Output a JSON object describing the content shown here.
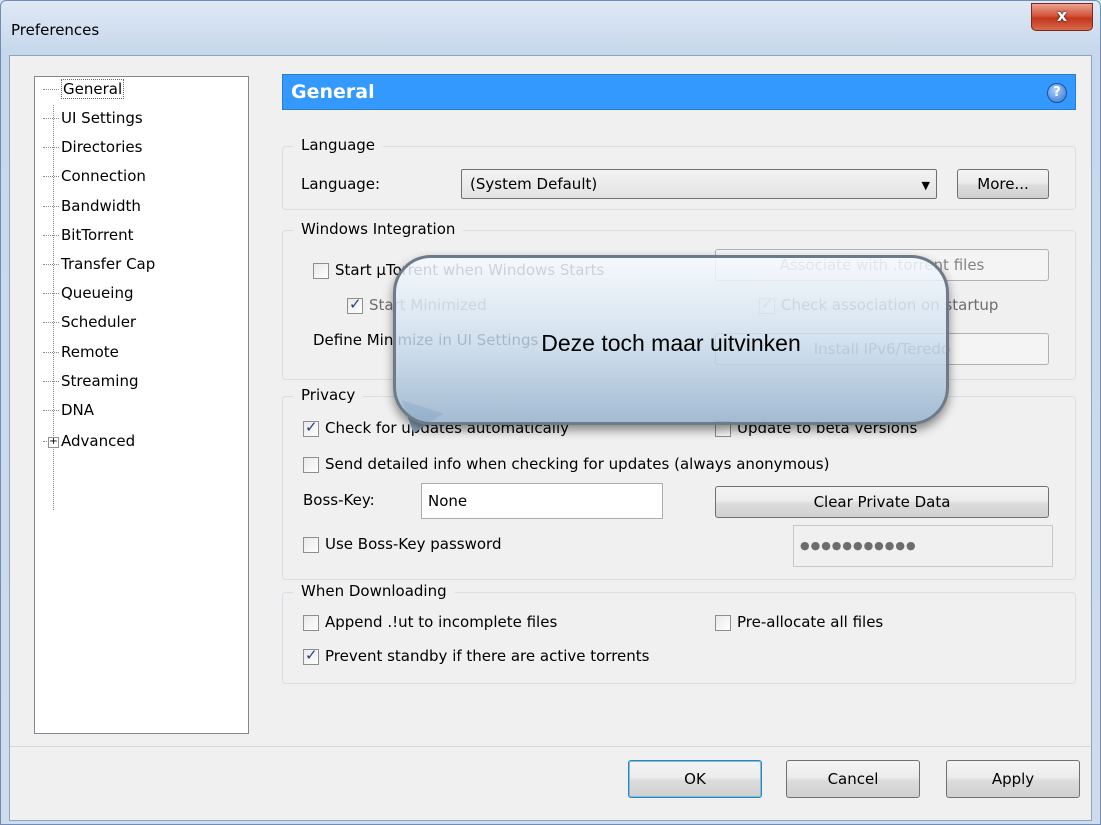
{
  "window": {
    "title": "Preferences",
    "close_label": "x"
  },
  "tree": {
    "items": [
      {
        "label": "General"
      },
      {
        "label": "UI Settings"
      },
      {
        "label": "Directories"
      },
      {
        "label": "Connection"
      },
      {
        "label": "Bandwidth"
      },
      {
        "label": "BitTorrent"
      },
      {
        "label": "Transfer Cap"
      },
      {
        "label": "Queueing"
      },
      {
        "label": "Scheduler"
      },
      {
        "label": "Remote"
      },
      {
        "label": "Streaming"
      },
      {
        "label": "DNA"
      },
      {
        "label": "Advanced"
      }
    ],
    "expander_symbol": "+"
  },
  "header": {
    "title": "General",
    "help": "?"
  },
  "language": {
    "group_title": "Language",
    "label": "Language:",
    "selected": "(System Default)",
    "more_button": "More..."
  },
  "windows_integration": {
    "group_title": "Windows Integration",
    "start_on_boot": "Start µTorrent when Windows Starts",
    "start_minimized": "Start Minimized",
    "associate_button": "Associate with .torrent files",
    "check_association": "Check association on startup",
    "define_minimize": "Define Minimize in UI Settings",
    "install_ipv6": "Install IPv6/Teredo"
  },
  "privacy": {
    "group_title": "Privacy",
    "check_updates": "Check for updates automatically",
    "beta_versions": "Update to beta versions",
    "send_info": "Send detailed info when checking for updates (always anonymous)",
    "boss_key_label": "Boss-Key:",
    "boss_key_value": "None",
    "clear_private": "Clear Private Data",
    "boss_password": "Use Boss-Key password",
    "password_mask": "●●●●●●●●●●●"
  },
  "downloading": {
    "group_title": "When Downloading",
    "append_ut": "Append .!ut to incomplete files",
    "preallocate": "Pre-allocate all files",
    "prevent_standby": "Prevent standby if there are active torrents"
  },
  "footer": {
    "ok": "OK",
    "cancel": "Cancel",
    "apply": "Apply"
  },
  "callout": {
    "text": "Deze toch maar uitvinken"
  }
}
